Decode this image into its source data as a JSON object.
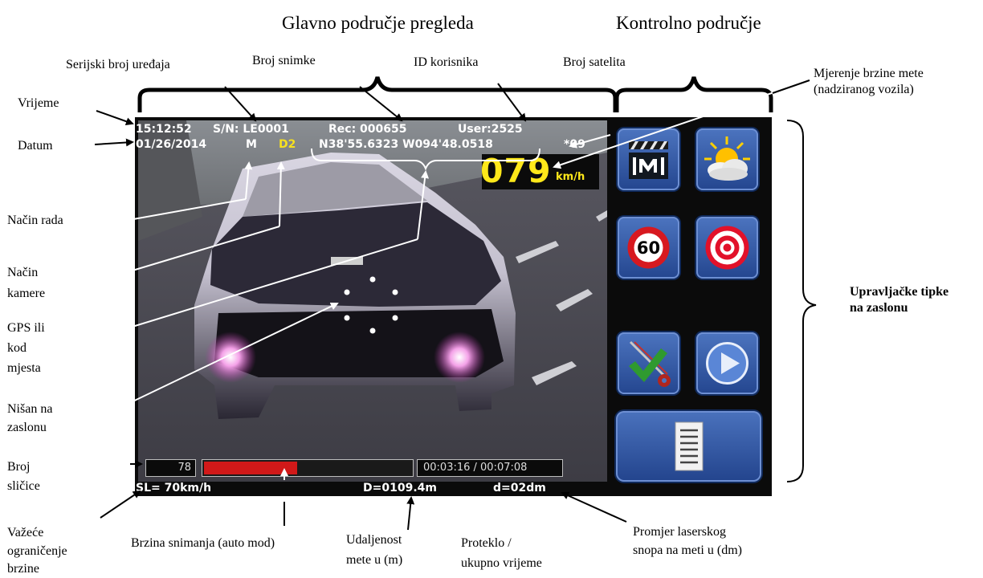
{
  "headers": {
    "main_view_area": "Glavno područje pregleda",
    "control_area": "Kontrolno područje"
  },
  "hud": {
    "time": "15:12:52",
    "serial": "S/N: LE0001",
    "record": "Rec: 000655",
    "user": "User:2525",
    "date": "01/26/2014",
    "mode": "M",
    "camera_mode": "D2",
    "gps": "N38'55.6323 W094'48.0518",
    "satellites": "*09",
    "speed_value": "079",
    "speed_unit": "km/h",
    "frame_number": "78",
    "recording_progress": 0.45,
    "elapsed_total": "00:03:16 / 00:07:08",
    "speed_limit": "SL= 70km/h",
    "distance": "D=0109.4m",
    "beam_diameter": "d=02dm"
  },
  "buttons": {
    "zoom_tool": "zoom-tool-icon",
    "weather": "weather-icon",
    "speed_limit_sign_text": "60",
    "speed_limit_sign": "speed-limit-sign-icon",
    "target": "target-icon",
    "check_settings": "check-settings-icon",
    "play": "play-icon",
    "menu": "menu-list-icon"
  },
  "labels": {
    "serial_number": "Serijski broj uređaja",
    "record_number": "Broj snimke",
    "user_id": "ID korisnika",
    "satellite_count": "Broj satelita",
    "target_speed_1": "Mjerenje brzine mete",
    "target_speed_2": "(nadziranog vozila)",
    "time": "Vrijeme",
    "date": "Datum",
    "operating_mode": "Način rada",
    "camera_mode_1": "Način",
    "camera_mode_2": "kamere",
    "gps_1": "GPS ili",
    "gps_2": "kod",
    "gps_3": "mjesta",
    "crosshair_1": "Nišan na",
    "crosshair_2": "zaslonu",
    "frame_count_1": "Broj",
    "frame_count_2": "sličice",
    "speed_limit_1": "Važeće",
    "speed_limit_2": "ograničenje",
    "speed_limit_3": "brzine",
    "recording_speed": "Brzina snimanja (auto mod)",
    "distance_1": "Udaljenost",
    "distance_2": "mete u (m)",
    "elapsed_1": "Proteklo /",
    "elapsed_2": "ukupno vrijeme",
    "beam_1": "Promjer laserskog",
    "beam_2": "snopa na meti u (dm)",
    "buttons_1": "Upravljačke tipke",
    "buttons_2": "na zaslonu"
  },
  "colors": {
    "hud_text": "#ffffff",
    "hud_highlight": "#f6e01e",
    "progress_fill": "#d11919",
    "button_blue": "#3a5fae"
  }
}
